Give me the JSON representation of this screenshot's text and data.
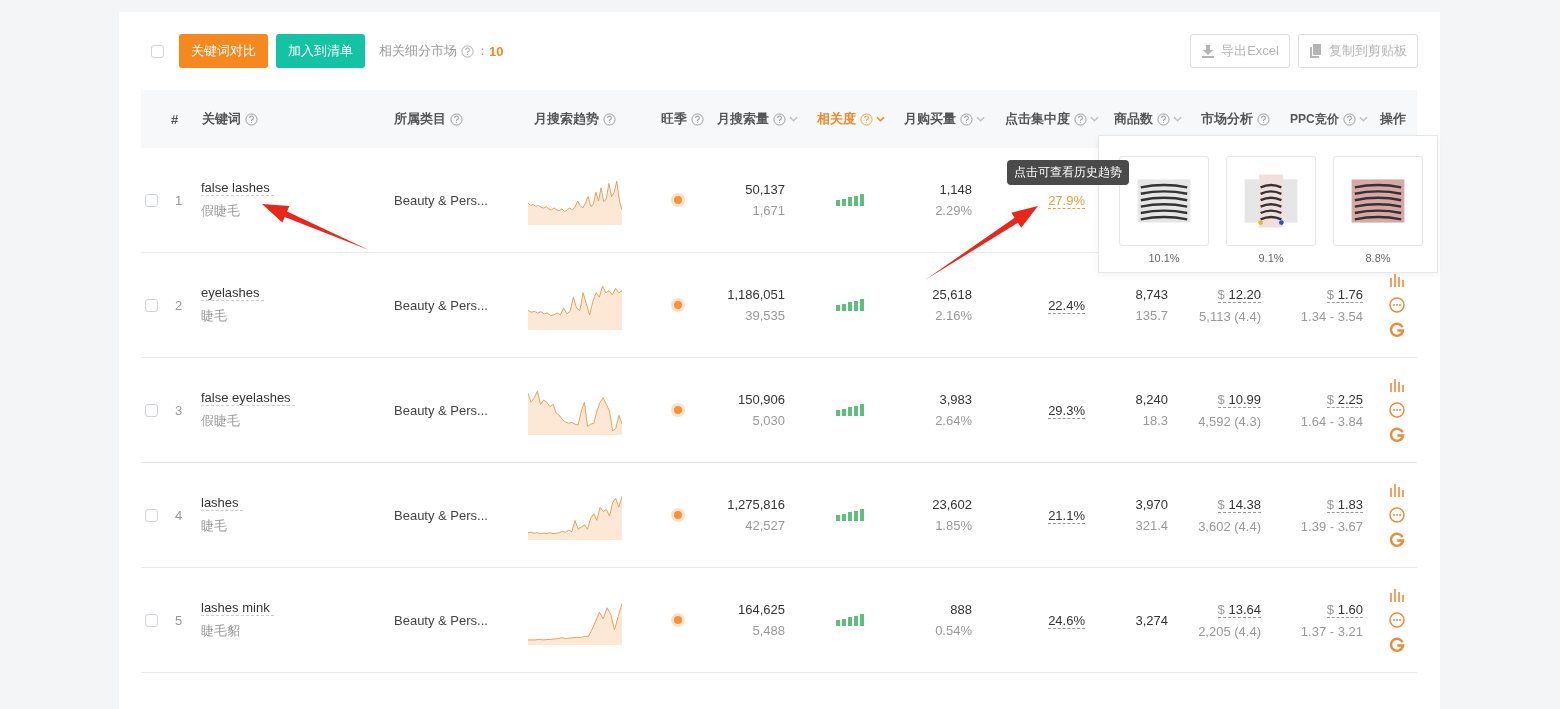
{
  "toolbar": {
    "select_all": {
      "checked": false
    },
    "buttons": [
      {
        "label": "关键词对比",
        "kind": "primary"
      },
      {
        "label": "加入到清单",
        "kind": "secondary"
      }
    ],
    "segment_label": "相关细分市场",
    "segment_separator": "：",
    "segment_count": "10",
    "export_buttons": [
      {
        "label": "导出Excel",
        "kind": "download",
        "disabled": true
      },
      {
        "label": "复制到剪贴板",
        "kind": "copy",
        "disabled": true
      }
    ]
  },
  "columns": [
    {
      "label": "#",
      "help": false,
      "sortable": false,
      "selected": false
    },
    {
      "label": "关键词",
      "help": true,
      "sortable": false,
      "selected": false
    },
    {
      "label": "所属类目",
      "help": true,
      "sortable": false,
      "selected": false
    },
    {
      "label": "月搜索趋势",
      "help": true,
      "sortable": false,
      "selected": false
    },
    {
      "label": "旺季",
      "help": true,
      "sortable": false,
      "selected": false
    },
    {
      "label": "月搜索量",
      "help": true,
      "sortable": true,
      "selected": false
    },
    {
      "label": "相关度",
      "help": true,
      "sortable": true,
      "selected": true
    },
    {
      "label": "月购买量",
      "help": true,
      "sortable": true,
      "selected": false
    },
    {
      "label": "点击集中度",
      "help": true,
      "sortable": true,
      "selected": false
    },
    {
      "label": "商品数",
      "help": true,
      "sortable": true,
      "selected": false
    },
    {
      "label": "市场分析",
      "help": true,
      "sortable": false,
      "selected": false
    },
    {
      "label": "PPC竞价",
      "help": true,
      "sortable": true,
      "selected": false
    },
    {
      "label": "操作",
      "help": false,
      "sortable": false,
      "selected": false
    }
  ],
  "rows": [
    {
      "checked": false,
      "index": "1",
      "keyword": "false lashes",
      "translation": "假睫毛",
      "category": "Beauty & Pers...",
      "peak_season": true,
      "searches": "50,137",
      "searches_daily": "1,671",
      "relevance": {
        "level": 1
      },
      "purchases": "1,148",
      "purchase_rate": "2.29%",
      "click_share": "27.9%",
      "click_highlighted": true,
      "tooltip": "点击可查看历史趋势",
      "actions_visible": false
    },
    {
      "checked": false,
      "index": "2",
      "keyword": "eyelashes",
      "translation": "睫毛",
      "category": "Beauty & Pers...",
      "peak_season": true,
      "searches": "1,186,051",
      "searches_daily": "39,535",
      "relevance": {
        "level": 1
      },
      "purchases": "25,618",
      "purchase_rate": "2.16%",
      "click_share": "22.4%",
      "click_highlighted": false,
      "products": "8,743",
      "products_ratio": "135.7",
      "currency": "$",
      "price": "12.20",
      "reviews": "5,113 (4.4)",
      "ppc": "1.76",
      "ppc_range": "1.34 - 3.54",
      "actions_visible": true
    },
    {
      "checked": false,
      "index": "3",
      "keyword": "false eyelashes",
      "translation": "假睫毛",
      "category": "Beauty & Pers...",
      "peak_season": true,
      "searches": "150,906",
      "searches_daily": "5,030",
      "relevance": {
        "level": 1
      },
      "purchases": "3,983",
      "purchase_rate": "2.64%",
      "click_share": "29.3%",
      "click_highlighted": false,
      "products": "8,240",
      "products_ratio": "18.3",
      "currency": "$",
      "price": "10.99",
      "reviews": "4,592 (4.3)",
      "ppc": "2.25",
      "ppc_range": "1.64 - 3.84",
      "actions_visible": true
    },
    {
      "checked": false,
      "index": "4",
      "keyword": "lashes",
      "translation": "睫毛",
      "category": "Beauty & Pers...",
      "peak_season": true,
      "searches": "1,275,816",
      "searches_daily": "42,527",
      "relevance": {
        "level": 1
      },
      "purchases": "23,602",
      "purchase_rate": "1.85%",
      "click_share": "21.1%",
      "click_highlighted": false,
      "products": "3,970",
      "products_ratio": "321.4",
      "currency": "$",
      "price": "14.38",
      "reviews": "3,602 (4.4)",
      "ppc": "1.83",
      "ppc_range": "1.39 - 3.67",
      "actions_visible": true
    },
    {
      "checked": false,
      "index": "5",
      "keyword": "lashes mink",
      "translation": "睫毛貂",
      "category": "Beauty & Pers...",
      "peak_season": true,
      "searches": "164,625",
      "searches_daily": "5,488",
      "relevance": {
        "level": 1
      },
      "purchases": "888",
      "purchase_rate": "0.54%",
      "click_share": "24.6%",
      "click_highlighted": false,
      "products": "3,274",
      "currency": "$",
      "price": "13.64",
      "reviews": "2,205 (4.4)",
      "ppc": "1.60",
      "ppc_range": "1.37 - 3.21",
      "actions_visible": true
    }
  ],
  "popover": {
    "products": [
      {
        "kind": "picture",
        "share": "10.1%"
      },
      {
        "kind": "picture",
        "share": "9.1%"
      },
      {
        "kind": "picture",
        "share": "8.8%"
      }
    ]
  },
  "annotation_arrows": [
    {
      "kind": "arrow"
    },
    {
      "kind": "arrow"
    }
  ]
}
